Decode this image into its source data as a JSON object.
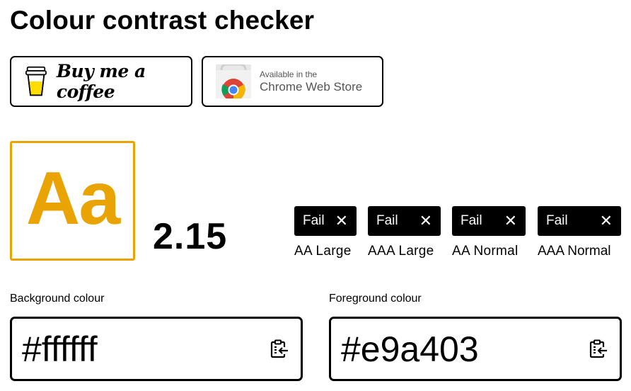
{
  "page": {
    "title": "Colour contrast checker"
  },
  "badges": {
    "bmc_label": "Buy me a coffee",
    "cws_small": "Available in the",
    "cws_big": "Chrome Web Store"
  },
  "preview": {
    "text": "Aa",
    "background": "#ffffff",
    "foreground": "#e9a403"
  },
  "ratio": "2.15",
  "results": [
    {
      "status": "Fail",
      "label": "AA Large"
    },
    {
      "status": "Fail",
      "label": "AAA Large"
    },
    {
      "status": "Fail",
      "label": "AA Normal"
    },
    {
      "status": "Fail",
      "label": "AAA Normal"
    }
  ],
  "background_field": {
    "label": "Background colour",
    "value": "#ffffff"
  },
  "foreground_field": {
    "label": "Foreground colour",
    "value": "#e9a403"
  },
  "icons": {
    "cup": "coffee-cup-icon",
    "chrome": "chrome-web-store-icon",
    "fail": "close-icon",
    "paste": "clipboard-paste-icon"
  }
}
